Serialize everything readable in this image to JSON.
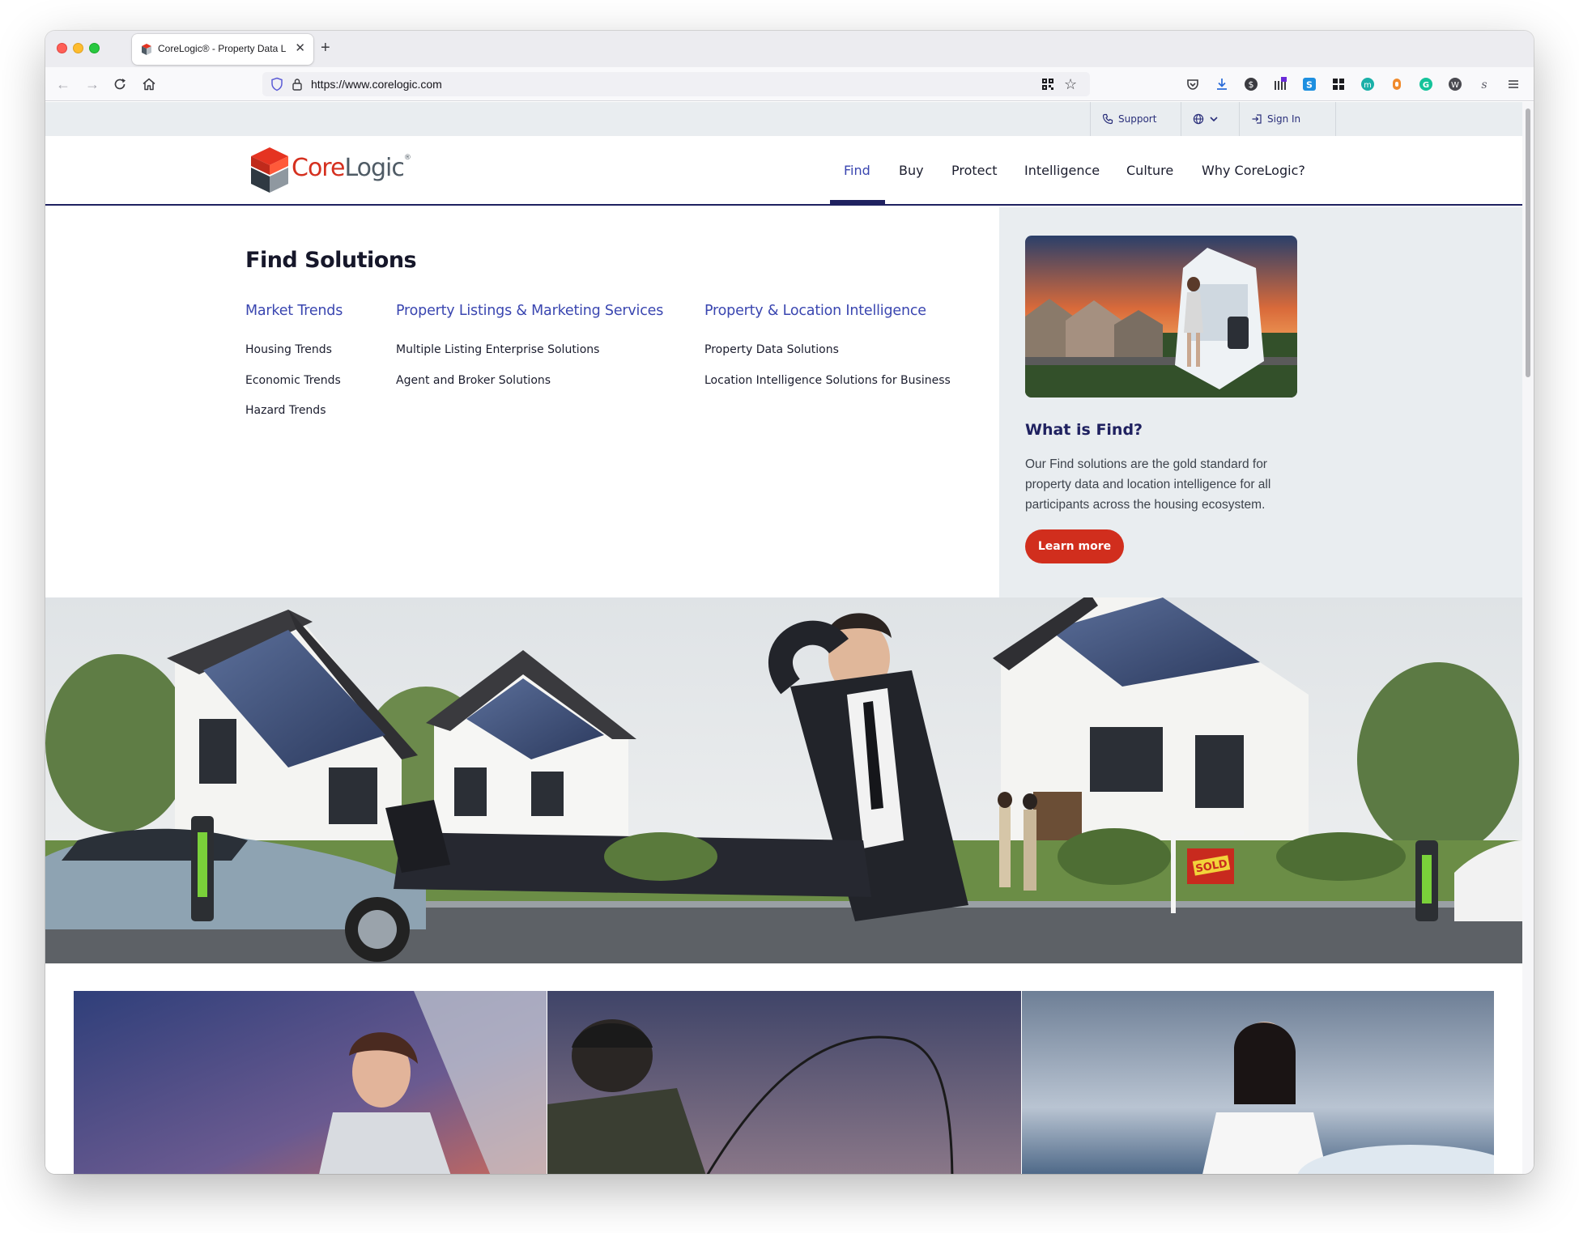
{
  "browser": {
    "tab_title": "CoreLogic® - Property Data Lea",
    "new_tab_symbol": "+",
    "close_symbol": "✕",
    "url": "https://www.corelogic.com"
  },
  "utility_bar": {
    "support_label": "Support",
    "signin_label": "Sign In"
  },
  "logo": {
    "core": "Core",
    "logic": "Logic",
    "mark": "®"
  },
  "nav": {
    "items": [
      "Find",
      "Buy",
      "Protect",
      "Intelligence",
      "Culture",
      "Why CoreLogic?"
    ],
    "active": "Find"
  },
  "mega_menu": {
    "title": "Find Solutions",
    "columns": [
      {
        "title": "Market Trends",
        "links": [
          "Housing Trends",
          "Economic Trends",
          "Hazard Trends"
        ]
      },
      {
        "title": "Property Listings & Marketing Services",
        "links": [
          "Multiple Listing Enterprise Solutions",
          "Agent and Broker Solutions"
        ]
      },
      {
        "title": "Property & Location Intelligence",
        "links": [
          "Property Data Solutions",
          "Location Intelligence Solutions for Business"
        ]
      }
    ],
    "side": {
      "heading": "What is Find?",
      "description": "Our Find solutions are the gold standard for property data and location intelligence for all participants across the housing ecosystem.",
      "button": "Learn more"
    }
  },
  "hero": {
    "sign_text": "SOLD"
  },
  "colors": {
    "brand_red": "#d12e1d",
    "brand_navy": "#1f2160",
    "link_blue": "#3a46b0",
    "panel_gray": "#e9edf0"
  }
}
